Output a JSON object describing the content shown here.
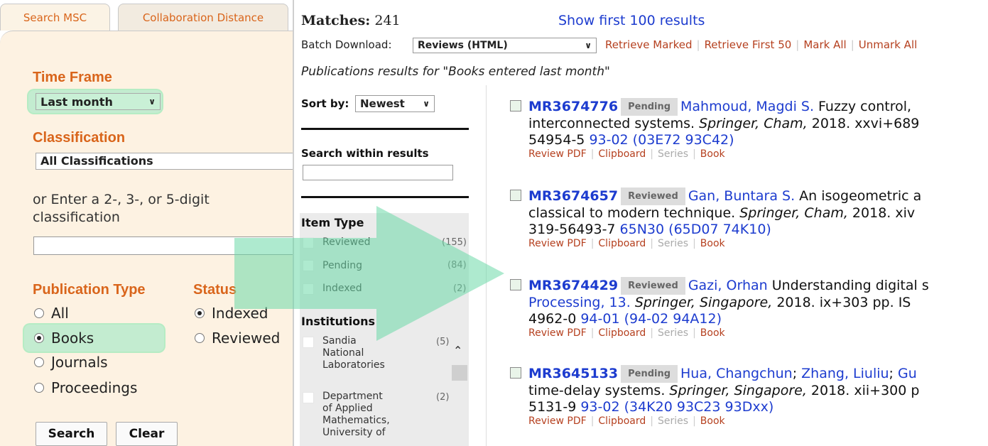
{
  "tabs": [
    "Search MSC",
    "Collaboration Distance"
  ],
  "left": {
    "time_frame_label": "Time Frame",
    "time_frame_value": "Last month",
    "classification_label": "Classification",
    "classification_value": "All Classifications",
    "enter_label_1": "or Enter a 2-, 3-, or 5-digit",
    "enter_label_2": "classification",
    "pub_type_label": "Publication Type",
    "status_label": "Status",
    "pub_types": [
      "All",
      "Books",
      "Journals",
      "Proceedings"
    ],
    "pub_selected": "Books",
    "statuses": [
      "Indexed",
      "Reviewed"
    ],
    "status_selected": "Indexed",
    "search_btn": "Search",
    "clear_btn": "Clear"
  },
  "results": {
    "matches_label": "Matches:",
    "matches_count": "241",
    "show_first": "Show first 100 results",
    "batch_label": "Batch Download:",
    "batch_value": "Reviews (HTML)",
    "actions": [
      "Retrieve Marked",
      "Retrieve First 50",
      "Mark All",
      "Unmark All"
    ],
    "subtitle": "Publications results for \"Books entered last month\"",
    "sort_label": "Sort by:",
    "sort_value": "Newest",
    "search_within": "Search within results",
    "item_type_label": "Item Type",
    "item_types": [
      {
        "label": "Reviewed",
        "count": "(155)"
      },
      {
        "label": "Pending",
        "count": "(84)"
      },
      {
        "label": "Indexed",
        "count": "(2)"
      }
    ],
    "institutions_label": "Institutions",
    "institutions": [
      {
        "lines": [
          "Sandia",
          "National",
          "Laboratories"
        ],
        "count": "(5)"
      },
      {
        "lines": [
          "Department",
          "of Applied",
          "Mathematics,",
          "University of"
        ],
        "count": "(2)"
      }
    ]
  },
  "records": [
    {
      "mr": "MR3674776",
      "status": "Pending",
      "author": "Mahmoud, Magdi S.",
      "title": " Fuzzy control,",
      "line2_a": "interconnected systems. ",
      "publisher": "Springer, Cham,",
      "line2_b": " 2018. xxvi+689",
      "line3_a": "54954-5 ",
      "line3_link": "93-02 (03E72 93C42)"
    },
    {
      "mr": "MR3674657",
      "status": "Reviewed",
      "author": "Gan, Buntara S.",
      "title": " An isogeometric a",
      "line2_a": "classical to modern technique. ",
      "publisher": "Springer, Cham,",
      "line2_b": " 2018. xiv",
      "line3_a": "319-56493-7 ",
      "line3_link": "65N30 (65D07 74K10)"
    },
    {
      "mr": "MR3674429",
      "status": "Reviewed",
      "author": "Gazi, Orhan",
      "title": " Understanding digital s",
      "line2_link": "Processing, 13.",
      "line2_a": " ",
      "publisher": "Springer, Singapore,",
      "line2_b": " 2018. ix+303 pp. IS",
      "line3_a": "4962-0 ",
      "line3_link": "94-01 (94-02 94A12)"
    },
    {
      "mr": "MR3645133",
      "status": "Pending",
      "author": "Hua, Changchun",
      "author2": "Zhang, Liuliu",
      "author3": "Gu",
      "title": "",
      "line2_a": "time-delay systems. ",
      "publisher": "Springer, Singapore,",
      "line2_b": " 2018. xii+300 p",
      "line3_a": "5131-9 ",
      "line3_link": "93-02 (34K20 93C23 93Dxx)"
    }
  ],
  "record_links": [
    "Review PDF",
    "Clipboard",
    "Series",
    "Book"
  ]
}
